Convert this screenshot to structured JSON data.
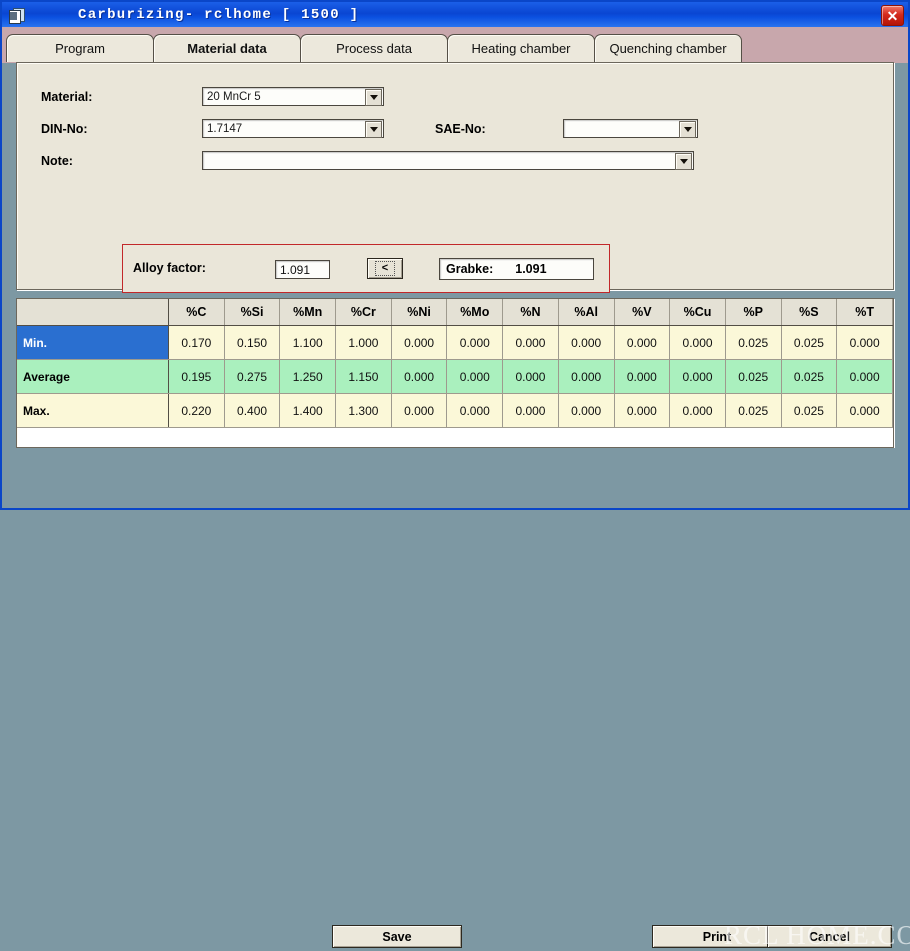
{
  "window": {
    "title": "Carburizing- rclhome   [ 1500 ]",
    "icon": "document-stack-icon",
    "close_label": "✕"
  },
  "tabs": [
    {
      "label": "Program",
      "selected": false
    },
    {
      "label": "Material data",
      "selected": true
    },
    {
      "label": "Process data",
      "selected": false
    },
    {
      "label": "Heating chamber",
      "selected": false
    },
    {
      "label": "Quenching chamber",
      "selected": false
    }
  ],
  "form": {
    "material_label": "Material:",
    "material_value": "20 MnCr 5",
    "din_label": "DIN-No:",
    "din_value": "1.7147",
    "sae_label": "SAE-No:",
    "sae_value": "",
    "note_label": "Note:",
    "note_value": ""
  },
  "alloy": {
    "label": "Alloy factor:",
    "value": "1.091",
    "button_label": "<",
    "grabke_label": "Grabke:",
    "grabke_value": "1.091",
    "border_color": "#c2282a"
  },
  "table": {
    "columns": [
      "%C",
      "%Si",
      "%Mn",
      "%Cr",
      "%Ni",
      "%Mo",
      "%N",
      "%Al",
      "%V",
      "%Cu",
      "%P",
      "%S",
      "%T"
    ],
    "rows": [
      {
        "label": "Min.",
        "style": "min",
        "values": [
          "0.170",
          "0.150",
          "1.100",
          "1.000",
          "0.000",
          "0.000",
          "0.000",
          "0.000",
          "0.000",
          "0.000",
          "0.025",
          "0.025",
          "0.000"
        ]
      },
      {
        "label": "Average",
        "style": "avg",
        "values": [
          "0.195",
          "0.275",
          "1.250",
          "1.150",
          "0.000",
          "0.000",
          "0.000",
          "0.000",
          "0.000",
          "0.000",
          "0.025",
          "0.025",
          "0.000"
        ]
      },
      {
        "label": "Max.",
        "style": "max",
        "values": [
          "0.220",
          "0.400",
          "1.400",
          "1.300",
          "0.000",
          "0.000",
          "0.000",
          "0.000",
          "0.000",
          "0.000",
          "0.025",
          "0.025",
          "0.000"
        ]
      }
    ],
    "row_colors": {
      "min": "#2a6fd0",
      "avg": "#aaf0be",
      "max": "#fbf8d8",
      "cell": "#fbf8d8"
    }
  },
  "footer": {
    "save_label": "Save",
    "print_label": "Print",
    "cancel_label": "Cancel",
    "watermark": "RCL HOME.COM"
  },
  "colors": {
    "titlebar": "#0a46d2",
    "tabstrip": "#c8a7ac",
    "panel": "#eae6d9",
    "bottombar": "#7d98a3",
    "window_border": "#0a46c8"
  }
}
